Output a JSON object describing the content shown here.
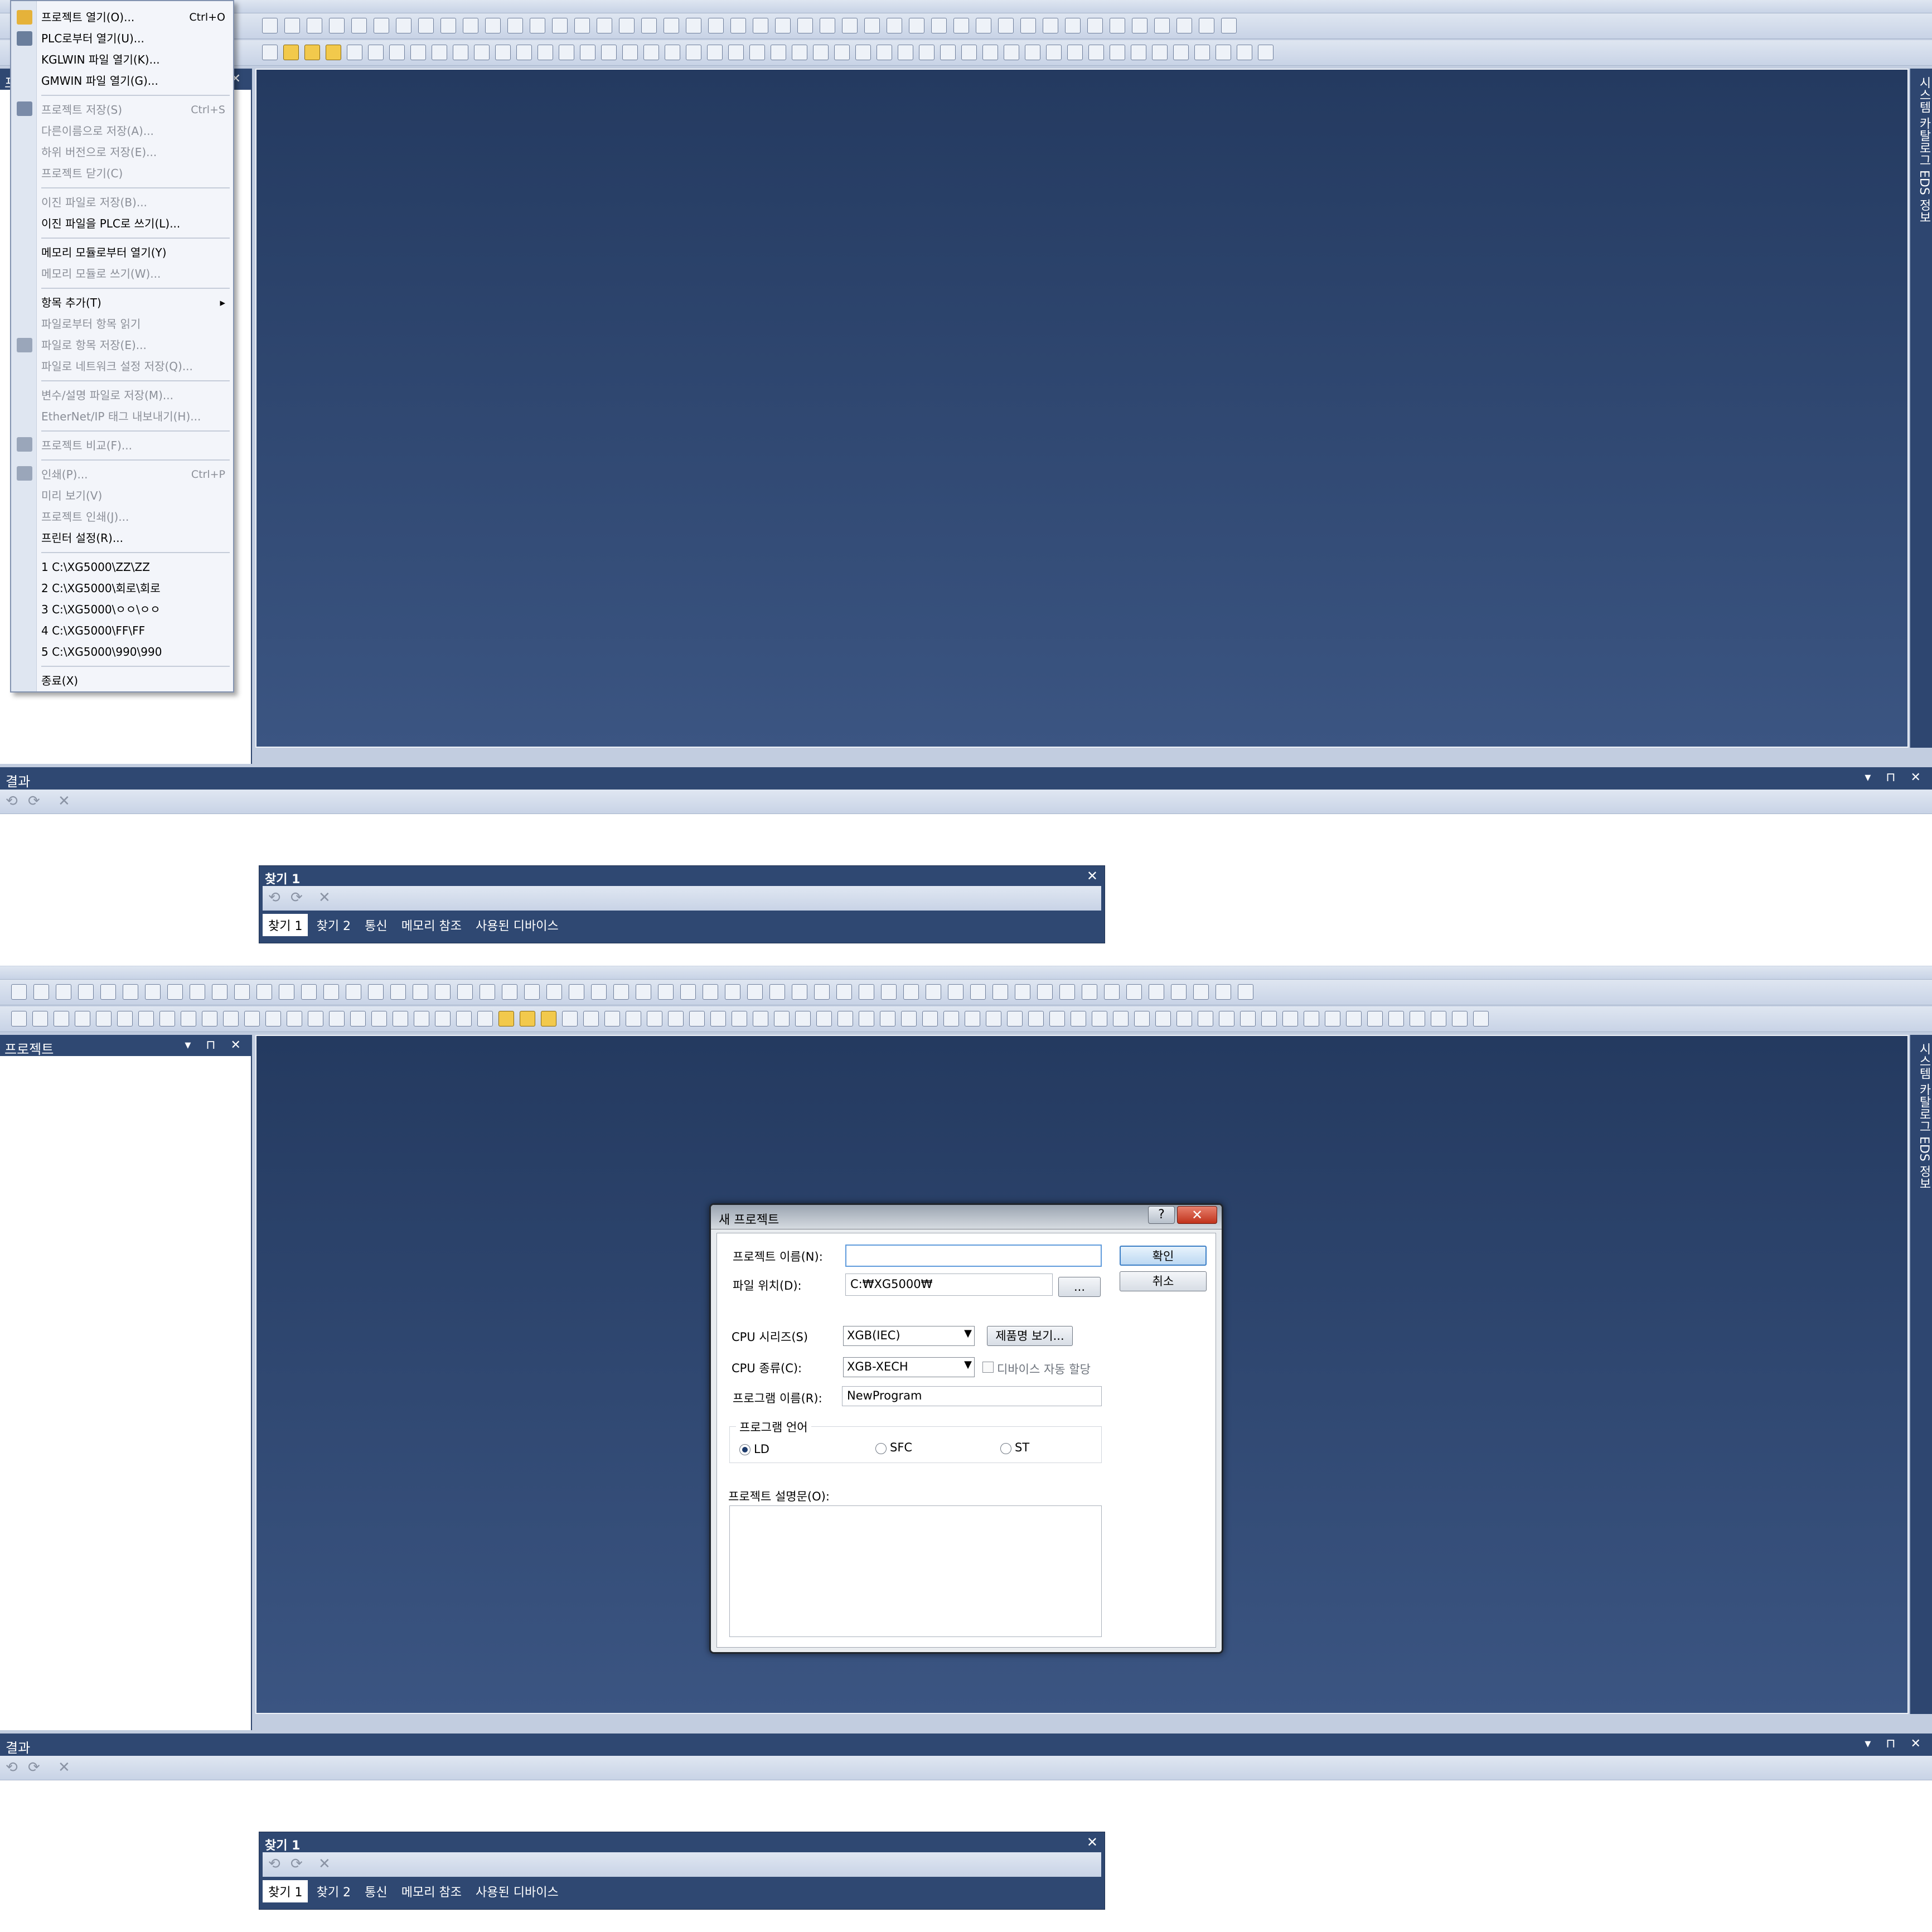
{
  "file_menu": {
    "items": [
      {
        "label": "프로젝트 열기(O)...",
        "shortcut": "Ctrl+O",
        "disabled": false
      },
      {
        "label": "PLC로부터 열기(U)...",
        "shortcut": "",
        "disabled": false
      },
      {
        "label": "KGLWIN 파일 열기(K)...",
        "shortcut": "",
        "disabled": false
      },
      {
        "label": "GMWIN 파일 열기(G)...",
        "shortcut": "",
        "disabled": false
      },
      {
        "label": "프로젝트 저장(S)",
        "shortcut": "Ctrl+S",
        "disabled": true
      },
      {
        "label": "다른이름으로 저장(A)...",
        "shortcut": "",
        "disabled": true
      },
      {
        "label": "하위 버전으로 저장(E)...",
        "shortcut": "",
        "disabled": true
      },
      {
        "label": "프로젝트 닫기(C)",
        "shortcut": "",
        "disabled": true
      },
      {
        "label": "이진 파일로 저장(B)...",
        "shortcut": "",
        "disabled": true
      },
      {
        "label": "이진 파일을 PLC로 쓰기(L)...",
        "shortcut": "",
        "disabled": false
      },
      {
        "label": "메모리 모듈로부터 열기(Y)",
        "shortcut": "",
        "disabled": false
      },
      {
        "label": "메모리 모듈로 쓰기(W)...",
        "shortcut": "",
        "disabled": true
      },
      {
        "label": "항목 추가(T)",
        "shortcut": "",
        "disabled": false
      },
      {
        "label": "파일로부터 항목 읽기",
        "shortcut": "",
        "disabled": true
      },
      {
        "label": "파일로 항목 저장(E)...",
        "shortcut": "",
        "disabled": true
      },
      {
        "label": "파일로 네트워크 설정 저장(Q)...",
        "shortcut": "",
        "disabled": true
      },
      {
        "label": "변수/설명 파일로 저장(M)...",
        "shortcut": "",
        "disabled": true
      },
      {
        "label": "EtherNet/IP 태그 내보내기(H)...",
        "shortcut": "",
        "disabled": true
      },
      {
        "label": "프로젝트 비교(F)...",
        "shortcut": "",
        "disabled": true
      },
      {
        "label": "인쇄(P)...",
        "shortcut": "Ctrl+P",
        "disabled": true
      },
      {
        "label": "미리 보기(V)",
        "shortcut": "",
        "disabled": true
      },
      {
        "label": "프로젝트 인쇄(J)...",
        "shortcut": "",
        "disabled": true
      },
      {
        "label": "프린터 설정(R)...",
        "shortcut": "",
        "disabled": false
      },
      {
        "label": "1 C:\\XG5000\\ZZ\\ZZ",
        "shortcut": "",
        "disabled": false
      },
      {
        "label": "2 C:\\XG5000\\회로\\회로",
        "shortcut": "",
        "disabled": false
      },
      {
        "label": "3 C:\\XG5000\\ㅇㅇ\\ㅇㅇ",
        "shortcut": "",
        "disabled": false
      },
      {
        "label": "4 C:\\XG5000\\FF\\FF",
        "shortcut": "",
        "disabled": false
      },
      {
        "label": "5 C:\\XG5000\\990\\990",
        "shortcut": "",
        "disabled": false
      },
      {
        "label": "종료(X)",
        "shortcut": "",
        "disabled": false
      }
    ]
  },
  "side_panel": {
    "title": "프로젝트"
  },
  "right_strip": {
    "label": "시스템 카탈로그 EDS 정보"
  },
  "result_panel": {
    "title": "결과"
  },
  "find_window": {
    "title": "찾기 1",
    "tabs": [
      "찾기 1",
      "찾기 2",
      "통신",
      "메모리 참조",
      "사용된 디바이스"
    ]
  },
  "dialog": {
    "title": "새 프로젝트",
    "help_label": "?",
    "close_label": "✕",
    "project_name_label": "프로젝트 이름(N):",
    "project_name_value": "",
    "file_location_label": "파일 위치(D):",
    "file_location_value": "C:₩XG5000₩",
    "browse_label": "...",
    "ok_label": "확인",
    "cancel_label": "취소",
    "cpu_series_label": "CPU 시리즈(S)",
    "cpu_series_value": "XGB(IEC)",
    "product_name_button": "제품명 보기...",
    "cpu_type_label": "CPU 종류(C):",
    "cpu_type_value": "XGB-XECH",
    "auto_device_label": "디바이스 자동 할당",
    "program_name_label": "프로그램 이름(R):",
    "program_name_value": "NewProgram",
    "language_group_label": "프로그램 언어",
    "lang_ld": "LD",
    "lang_sfc": "SFC",
    "lang_st": "ST",
    "description_label": "프로젝트 설명문(O):"
  },
  "colors": {
    "workspace": "#2b4269",
    "panel_header": "#2f4872",
    "dialog_close": "#c0321b"
  }
}
